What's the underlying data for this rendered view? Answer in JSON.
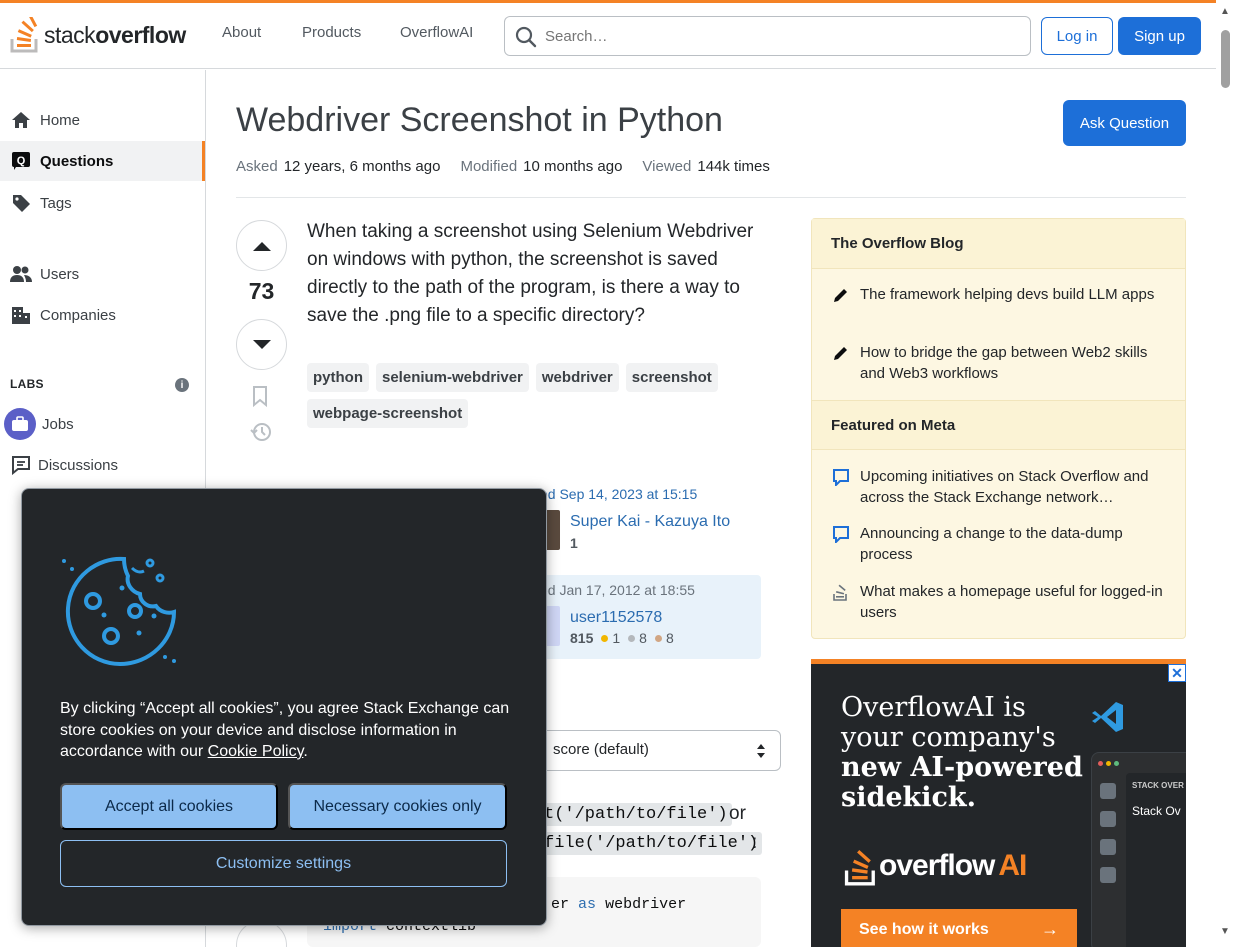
{
  "header": {
    "logo": {
      "prefix": "stack",
      "suffix": "overflow"
    },
    "nav": [
      "About",
      "Products",
      "OverflowAI"
    ],
    "search_placeholder": "Search…",
    "login": "Log in",
    "signup": "Sign up"
  },
  "sidebar": {
    "items": [
      {
        "label": "Home",
        "icon": "home-icon"
      },
      {
        "label": "Questions",
        "icon": "questions-icon",
        "active": true
      },
      {
        "label": "Tags",
        "icon": "tag-icon"
      },
      {
        "label": "Users",
        "icon": "users-icon"
      },
      {
        "label": "Companies",
        "icon": "companies-icon"
      }
    ],
    "labs_title": "LABS",
    "labs_items": [
      {
        "label": "Jobs",
        "icon": "jobs-icon"
      },
      {
        "label": "Discussions",
        "icon": "discussions-icon"
      }
    ]
  },
  "question": {
    "title": "Webdriver Screenshot in Python",
    "ask_button": "Ask Question",
    "meta": [
      {
        "key": "Asked",
        "value": "12 years, 6 months ago"
      },
      {
        "key": "Modified",
        "value": "10 months ago"
      },
      {
        "key": "Viewed",
        "value": "144k times"
      }
    ],
    "votes": "73",
    "body": "When taking a screenshot using Selenium Webdriver on windows with python, the screenshot is saved directly to the path of the program, is there a way to save the .png file to a specific directory?",
    "tags": [
      "python",
      "selenium-webdriver",
      "webdriver",
      "screenshot",
      "webpage-screenshot"
    ],
    "edited": "ed Sep 14, 2023 at 15:15",
    "editor_name": "Super Kai - Kazuya Ito",
    "editor_rep": "1",
    "asked_line": "ed Jan 17, 2012 at 18:55",
    "asker_name": "user1152578",
    "asker_rep": "815",
    "asker_gold": "1",
    "asker_silver": "8",
    "asker_bronze": "8",
    "sort_value": "score (default)",
    "code_inline_1": "t('/path/to/file')",
    "code_or": "or",
    "code_inline_2": "file('/path/to/file')",
    "code_colon": ":",
    "code_line_1a": "er",
    "code_line_1b": "as",
    "code_line_1c": "webdriver",
    "code_line_2a": "import",
    "code_line_2b": "contextlib"
  },
  "blog": {
    "section1_title": "The Overflow Blog",
    "section1_items": [
      "The framework helping devs build LLM apps",
      "How to bridge the gap between Web2 skills and Web3 workflows"
    ],
    "section2_title": "Featured on Meta",
    "section2_items": [
      "Upcoming initiatives on Stack Overflow and across the Stack Exchange network…",
      "Announcing a change to the data-dump process",
      "What makes a homepage useful for logged-in users"
    ]
  },
  "ad": {
    "close": "✕",
    "headline_1": "OverflowAI is",
    "headline_2": "your company's",
    "headline_3": "new AI-powered",
    "headline_4": "sidekick.",
    "brand_text": "overflow",
    "brand_ai": "AI",
    "cta": "See how it works",
    "mock_title": "STACK OVER",
    "mock_sub": "Stack Ov"
  },
  "cookie": {
    "text_before": "By clicking “Accept all cookies”, you agree Stack Exchange can store cookies on your device and disclose information in accordance with our ",
    "link": "Cookie Policy",
    "text_after": ".",
    "accept": "Accept all cookies",
    "necessary": "Necessary cookies only",
    "customize": "Customize settings"
  },
  "colors": {
    "accent": "#f48225",
    "primary": "#1d6fd8",
    "cookie_bg": "#232629",
    "cookie_btn": "#8dbff2"
  }
}
